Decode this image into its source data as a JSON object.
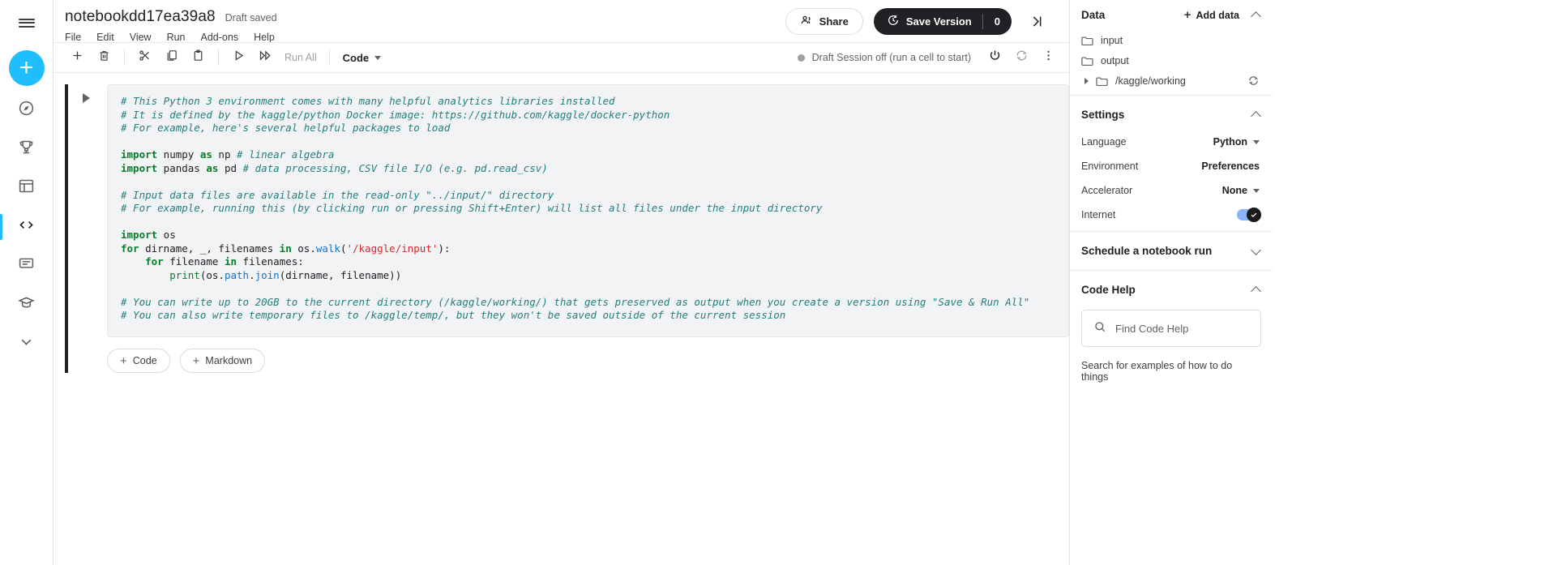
{
  "rail": {
    "menu_label": "menu",
    "create_label": "create",
    "items": [
      {
        "name": "home",
        "label": "Home"
      },
      {
        "name": "competitions",
        "label": "Competitions"
      },
      {
        "name": "datasets",
        "label": "Datasets"
      },
      {
        "name": "code",
        "label": "Code"
      },
      {
        "name": "discussions",
        "label": "Discussions"
      },
      {
        "name": "learn",
        "label": "Learn"
      },
      {
        "name": "more",
        "label": "More"
      }
    ]
  },
  "header": {
    "title": "notebookdd17ea39a8",
    "draft_status": "Draft saved",
    "menus": [
      "File",
      "Edit",
      "View",
      "Run",
      "Add-ons",
      "Help"
    ],
    "share_label": "Share",
    "save_version_label": "Save Version",
    "version_count": "0"
  },
  "toolbar": {
    "run_all_label": "Run All",
    "cell_type": "Code",
    "session_status": "Draft Session off (run a cell to start)",
    "buttons": [
      {
        "name": "add-cell",
        "label": "Add cell"
      },
      {
        "name": "delete-cell",
        "label": "Delete cell"
      },
      {
        "name": "cut-cell",
        "label": "Cut"
      },
      {
        "name": "copy-cell",
        "label": "Copy"
      },
      {
        "name": "paste-cell",
        "label": "Paste"
      },
      {
        "name": "run-cell",
        "label": "Run"
      },
      {
        "name": "run-all",
        "label": "Run all"
      },
      {
        "name": "power",
        "label": "Power"
      },
      {
        "name": "restart",
        "label": "Restart"
      },
      {
        "name": "more-options",
        "label": "More"
      }
    ]
  },
  "cell": {
    "add_code_label": "Code",
    "add_markdown_label": "Markdown",
    "lines": [
      [
        {
          "t": "com",
          "s": "# This Python 3 environment comes with many helpful analytics libraries installed"
        }
      ],
      [
        {
          "t": "com",
          "s": "# It is defined by the kaggle/python Docker image: https://github.com/kaggle/docker-python"
        }
      ],
      [
        {
          "t": "com",
          "s": "# For example, here's several helpful packages to load"
        }
      ],
      [],
      [
        {
          "t": "kw",
          "s": "import"
        },
        {
          "t": "pun",
          "s": " numpy "
        },
        {
          "t": "kw",
          "s": "as"
        },
        {
          "t": "pun",
          "s": " np "
        },
        {
          "t": "com",
          "s": "# linear algebra"
        }
      ],
      [
        {
          "t": "kw",
          "s": "import"
        },
        {
          "t": "pun",
          "s": " pandas "
        },
        {
          "t": "kw",
          "s": "as"
        },
        {
          "t": "pun",
          "s": " pd "
        },
        {
          "t": "com",
          "s": "# data processing, CSV file I/O (e.g. pd.read_csv)"
        }
      ],
      [],
      [
        {
          "t": "com",
          "s": "# Input data files are available in the read-only \"../input/\" directory"
        }
      ],
      [
        {
          "t": "com",
          "s": "# For example, running this (by clicking run or pressing Shift+Enter) will list all files under the input directory"
        }
      ],
      [],
      [
        {
          "t": "kw",
          "s": "import"
        },
        {
          "t": "pun",
          "s": " os"
        }
      ],
      [
        {
          "t": "kw",
          "s": "for"
        },
        {
          "t": "pun",
          "s": " dirname, _, filenames "
        },
        {
          "t": "kw",
          "s": "in"
        },
        {
          "t": "pun",
          "s": " os."
        },
        {
          "t": "fn",
          "s": "walk"
        },
        {
          "t": "pun",
          "s": "("
        },
        {
          "t": "str",
          "s": "'/kaggle/input'"
        },
        {
          "t": "pun",
          "s": "):"
        }
      ],
      [
        {
          "t": "pun",
          "s": "    "
        },
        {
          "t": "kw",
          "s": "for"
        },
        {
          "t": "pun",
          "s": " filename "
        },
        {
          "t": "kw",
          "s": "in"
        },
        {
          "t": "pun",
          "s": " filenames:"
        }
      ],
      [
        {
          "t": "pun",
          "s": "        "
        },
        {
          "t": "bi",
          "s": "print"
        },
        {
          "t": "pun",
          "s": "(os."
        },
        {
          "t": "fn",
          "s": "path"
        },
        {
          "t": "pun",
          "s": "."
        },
        {
          "t": "fn",
          "s": "join"
        },
        {
          "t": "pun",
          "s": "(dirname, filename))"
        }
      ],
      [],
      [
        {
          "t": "com",
          "s": "# You can write up to 20GB to the current directory (/kaggle/working/) that gets preserved as output when you create a version using \"Save & Run All\""
        }
      ],
      [
        {
          "t": "com",
          "s": "# You can also write temporary files to /kaggle/temp/, but they won't be saved outside of the current session"
        }
      ]
    ]
  },
  "sidebar": {
    "data": {
      "title": "Data",
      "add_label": "Add data",
      "items": [
        {
          "name": "input",
          "label": "input"
        },
        {
          "name": "output",
          "label": "output"
        },
        {
          "name": "kaggle-working",
          "label": "/kaggle/working"
        }
      ]
    },
    "settings": {
      "title": "Settings",
      "rows": [
        {
          "name": "language",
          "label": "Language",
          "value": "Python",
          "control": "dropdown"
        },
        {
          "name": "environment",
          "label": "Environment",
          "value": "Preferences",
          "control": "link"
        },
        {
          "name": "accelerator",
          "label": "Accelerator",
          "value": "None",
          "control": "dropdown"
        },
        {
          "name": "internet",
          "label": "Internet",
          "value": "on",
          "control": "toggle"
        }
      ]
    },
    "schedule": {
      "title": "Schedule a notebook run"
    },
    "code_help": {
      "title": "Code Help",
      "search_placeholder": "Find Code Help",
      "hint": "Search for examples of how to do things"
    }
  }
}
